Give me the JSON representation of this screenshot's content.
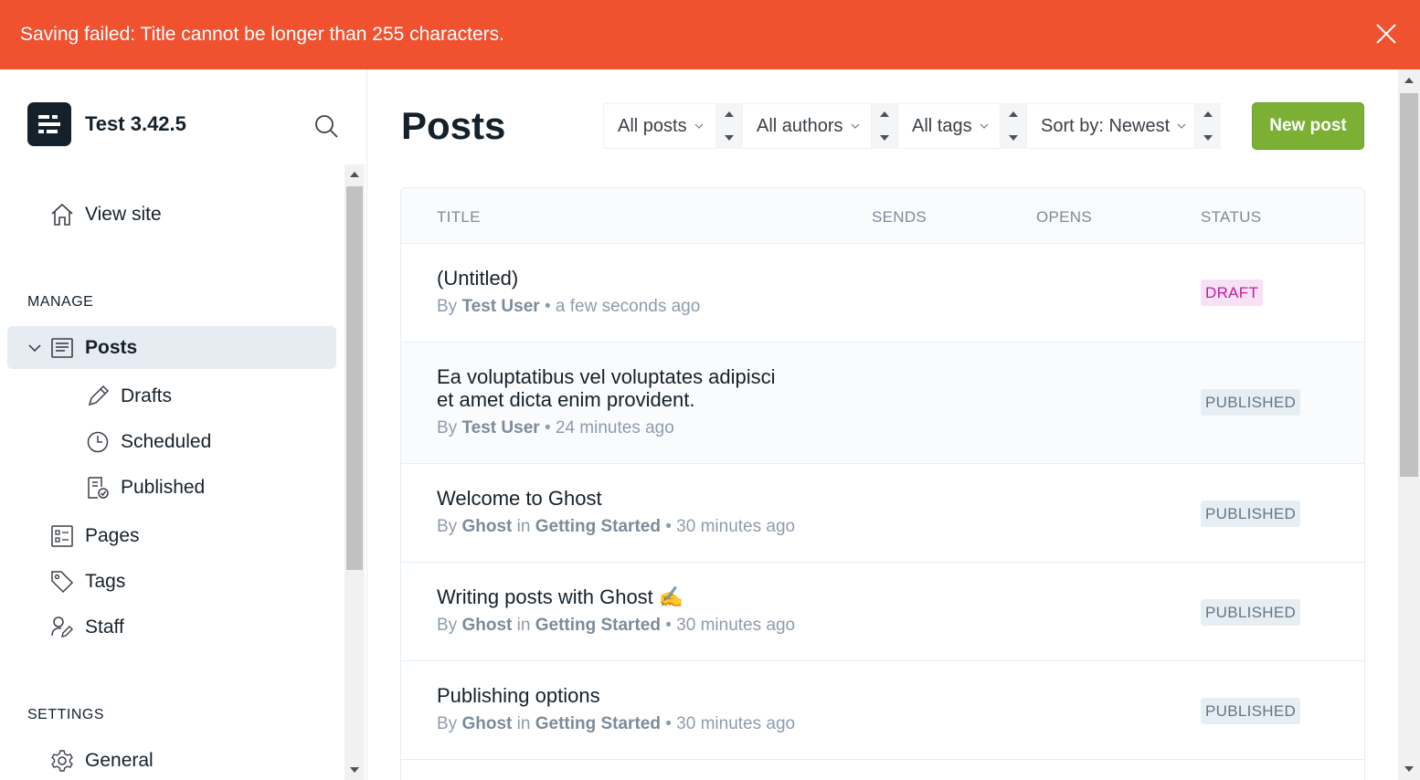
{
  "alert": {
    "message": "Saving failed: Title cannot be longer than 255 characters.",
    "close_icon": "close-icon",
    "color": "#f05230"
  },
  "sidebar": {
    "brand_title": "Test 3.42.5",
    "view_site": "View site",
    "manage_label": "MANAGE",
    "posts": "Posts",
    "drafts": "Drafts",
    "scheduled": "Scheduled",
    "published": "Published",
    "pages": "Pages",
    "tags": "Tags",
    "staff": "Staff",
    "settings_label": "SETTINGS",
    "general": "General"
  },
  "main": {
    "title": "Posts",
    "filters": {
      "type": "All posts",
      "author": "All authors",
      "tag": "All tags",
      "sort": "Sort by: Newest"
    },
    "new_post": "New post",
    "accent": "#7bb034",
    "columns": {
      "title": "TITLE",
      "sends": "SENDS",
      "opens": "OPENS",
      "status": "STATUS"
    },
    "posts": [
      {
        "title": "(Untitled)",
        "by": "By",
        "author": "Test User",
        "in": "",
        "tag": "",
        "time": "a few seconds ago",
        "status": "DRAFT"
      },
      {
        "title_line1": "Ea voluptatibus vel voluptates adipisci",
        "title_line2": "et amet dicta enim provident.",
        "by": "By",
        "author": "Test User",
        "time": "24 minutes ago",
        "status": "PUBLISHED"
      },
      {
        "title": "Welcome to Ghost",
        "by": "By",
        "author": "Ghost",
        "in": "in",
        "tag": "Getting Started",
        "time": "30 minutes ago",
        "status": "PUBLISHED"
      },
      {
        "title": "Writing posts with Ghost",
        "emoji": "✍️",
        "by": "By",
        "author": "Ghost",
        "in": "in",
        "tag": "Getting Started",
        "time": "30 minutes ago",
        "status": "PUBLISHED"
      },
      {
        "title": "Publishing options",
        "by": "By",
        "author": "Ghost",
        "in": "in",
        "tag": "Getting Started",
        "time": "30 minutes ago",
        "status": "PUBLISHED"
      }
    ],
    "separator": "•"
  }
}
